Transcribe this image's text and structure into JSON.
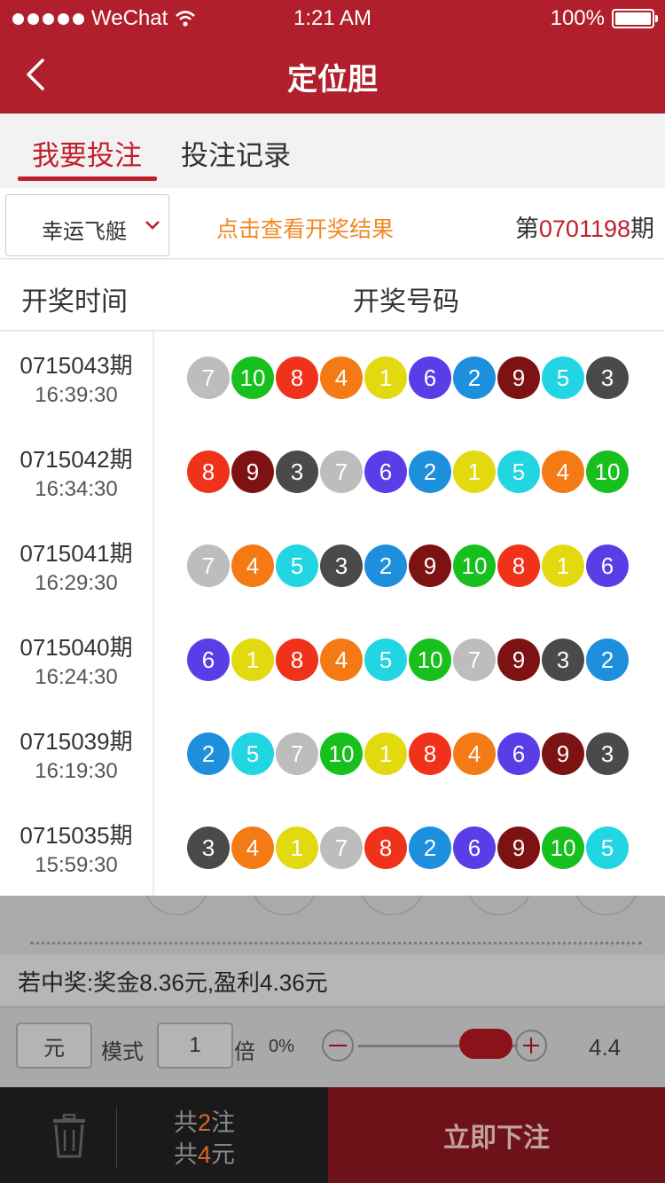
{
  "status_bar": {
    "carrier": "WeChat",
    "time": "1:21 AM",
    "battery": "100%"
  },
  "nav": {
    "title": "定位胆"
  },
  "tabs": [
    {
      "label": "我要投注",
      "active": true
    },
    {
      "label": "投注记录",
      "active": false
    }
  ],
  "lottery": {
    "name": "幸运飞艇",
    "view_results": "点击查看开奖结果",
    "period_prefix": "第",
    "period_number": "0701198",
    "period_suffix": "期"
  },
  "results": {
    "col_time": "开奖时间",
    "col_numbers": "开奖号码",
    "rows": [
      {
        "period": "0715043期",
        "time": "16:39:30",
        "numbers": [
          7,
          10,
          8,
          4,
          1,
          6,
          2,
          9,
          5,
          3
        ]
      },
      {
        "period": "0715042期",
        "time": "16:34:30",
        "numbers": [
          8,
          9,
          3,
          7,
          6,
          2,
          1,
          5,
          4,
          10
        ]
      },
      {
        "period": "0715041期",
        "time": "16:29:30",
        "numbers": [
          7,
          4,
          5,
          3,
          2,
          9,
          10,
          8,
          1,
          6
        ]
      },
      {
        "period": "0715040期",
        "time": "16:24:30",
        "numbers": [
          6,
          1,
          8,
          4,
          5,
          10,
          7,
          9,
          3,
          2
        ]
      },
      {
        "period": "0715039期",
        "time": "16:19:30",
        "numbers": [
          2,
          5,
          7,
          10,
          1,
          8,
          4,
          6,
          9,
          3
        ]
      },
      {
        "period": "0715035期",
        "time": "15:59:30",
        "numbers": [
          3,
          4,
          1,
          7,
          8,
          2,
          6,
          9,
          10,
          5
        ]
      }
    ]
  },
  "ball_colors": {
    "1": "#e3d90f",
    "2": "#1e8fdc",
    "3": "#4a4a4a",
    "4": "#f47a15",
    "5": "#22d5e2",
    "6": "#5b3de8",
    "7": "#bdbdbd",
    "8": "#f0321a",
    "9": "#7d1212",
    "10": "#18c01e"
  },
  "prize": {
    "text": "若中奖:奖金8.36元,盈利4.36元"
  },
  "controls": {
    "unit": "元",
    "mode_label": "模式",
    "times_value": "1",
    "times_label": "倍",
    "rebate_percent": "0%",
    "odds_value": "4.4"
  },
  "footer": {
    "line1_prefix": "共",
    "bets_count": "2",
    "line1_suffix": "注",
    "line2_prefix": "共",
    "amount": "4",
    "line2_suffix": "元",
    "submit_label": "立即下注"
  },
  "colors": {
    "brand": "#b01f2b",
    "accent_orange": "#f08a26",
    "submit_bg": "#6c1218"
  }
}
